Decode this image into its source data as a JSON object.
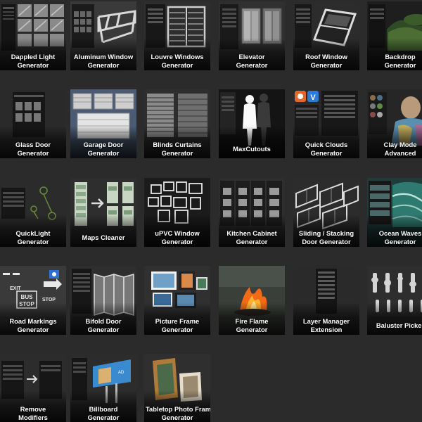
{
  "grid": {
    "items": [
      {
        "line1": "Dappled Light",
        "line2": "Generator",
        "icon": "dappled-light-thumbnail"
      },
      {
        "line1": "Aluminum Window",
        "line2": "Generator",
        "icon": "aluminum-window-thumbnail"
      },
      {
        "line1": "Louvre Windows",
        "line2": "Generator",
        "icon": "louvre-windows-thumbnail"
      },
      {
        "line1": "Elevator",
        "line2": "Generator",
        "icon": "elevator-thumbnail"
      },
      {
        "line1": "Roof Window",
        "line2": "Generator",
        "icon": "roof-window-thumbnail"
      },
      {
        "line1": "Backdrop",
        "line2": "Generator",
        "icon": "backdrop-thumbnail"
      },
      {
        "line1": "Glass Door",
        "line2": "Generator",
        "icon": "glass-door-thumbnail"
      },
      {
        "line1": "Garage Door",
        "line2": "Generator",
        "icon": "garage-door-thumbnail"
      },
      {
        "line1": "Blinds Curtains",
        "line2": "Generator",
        "icon": "blinds-curtains-thumbnail"
      },
      {
        "line1": "MaxCutouts",
        "line2": "",
        "icon": "maxcutouts-thumbnail"
      },
      {
        "line1": "Quick Clouds",
        "line2": "Generator",
        "icon": "quick-clouds-thumbnail"
      },
      {
        "line1": "Clay Mode",
        "line2": "Advanced",
        "icon": "clay-mode-thumbnail"
      },
      {
        "line1": "QuickLight",
        "line2": "Generator",
        "icon": "quicklight-thumbnail"
      },
      {
        "line1": "Maps Cleaner",
        "line2": "",
        "icon": "maps-cleaner-thumbnail"
      },
      {
        "line1": "uPVC Window",
        "line2": "Generator",
        "icon": "upvc-window-thumbnail"
      },
      {
        "line1": "Kitchen Cabinet",
        "line2": "Generator",
        "icon": "kitchen-cabinet-thumbnail"
      },
      {
        "line1": "Sliding / Stacking",
        "line2": "Door Generator",
        "icon": "sliding-door-thumbnail"
      },
      {
        "line1": "Ocean Waves",
        "line2": "Generator",
        "icon": "ocean-waves-thumbnail"
      },
      {
        "line1": "Road Markings",
        "line2": "Generator",
        "icon": "road-markings-thumbnail"
      },
      {
        "line1": "Bifold Door",
        "line2": "Generator",
        "icon": "bifold-door-thumbnail"
      },
      {
        "line1": "Picture Frame",
        "line2": "Generator",
        "icon": "picture-frame-thumbnail"
      },
      {
        "line1": "Fire Flame",
        "line2": "Generator",
        "icon": "fire-flame-thumbnail"
      },
      {
        "line1": "Layer Manager",
        "line2": "Extension",
        "icon": "layer-manager-thumbnail"
      },
      {
        "line1": "Baluster Picker",
        "line2": "",
        "icon": "baluster-picker-thumbnail"
      },
      {
        "line1": "Remove",
        "line2": "Modifiers",
        "icon": "remove-modifiers-thumbnail"
      },
      {
        "line1": "Billboard",
        "line2": "Generator",
        "icon": "billboard-thumbnail"
      },
      {
        "line1": "Tabletop Photo Frame",
        "line2": "Generator",
        "icon": "tabletop-photo-frame-thumbnail"
      }
    ]
  },
  "colors": {
    "background": "#2b2b2b",
    "tile": "#1a1a1a",
    "label": "#ffffff"
  }
}
